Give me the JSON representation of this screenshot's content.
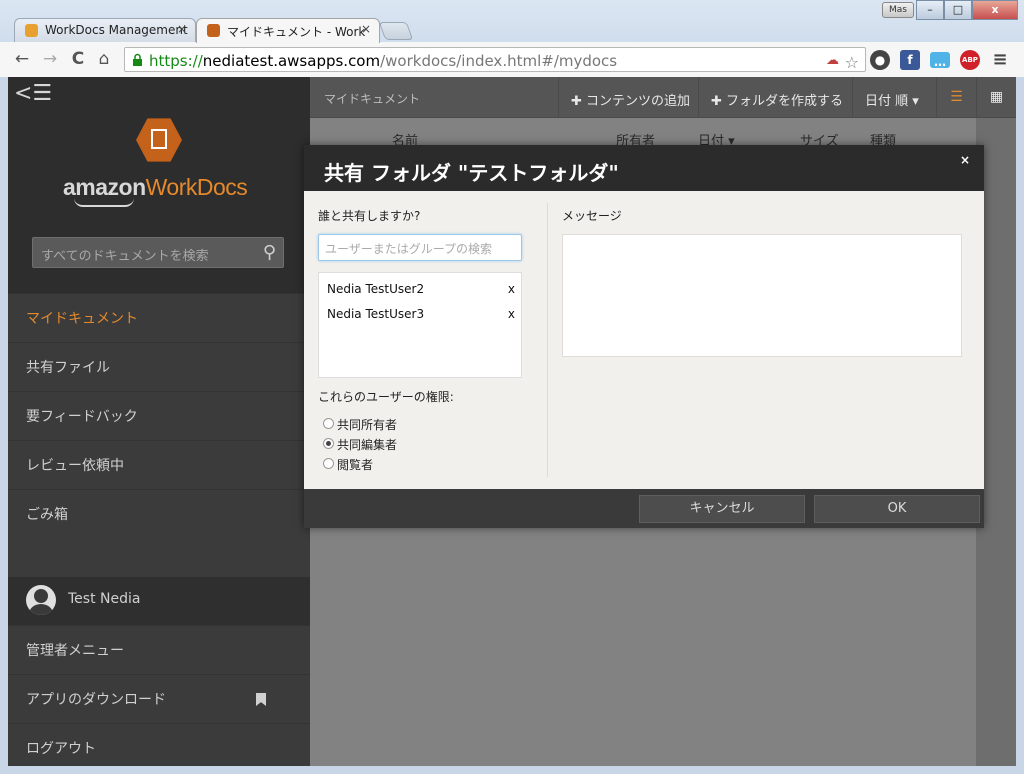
{
  "browser": {
    "tabs": [
      {
        "title": "WorkDocs Management",
        "close": "×"
      },
      {
        "title": "マイドキュメント - Work",
        "close": "×"
      }
    ],
    "user_badge": "Mas",
    "window_buttons": {
      "minimize": "–",
      "maximize": "□",
      "close": "x"
    },
    "nav": {
      "back": "←",
      "forward": "→",
      "reload": "C",
      "home": "⌂"
    },
    "url": {
      "scheme": "https://",
      "host": "nediatest.awsapps.com",
      "path": "/workdocs/index.html#/mydocs"
    },
    "extensions": {
      "abp": "ABP",
      "menu": "≡"
    }
  },
  "sidebar": {
    "collapse_icon": "<☰",
    "logo": {
      "amazon": "amazon",
      "workdocs": "WorkDocs"
    },
    "search_placeholder": "すべてのドキュメントを検索",
    "nav": [
      {
        "label": "マイドキュメント",
        "active": true
      },
      {
        "label": "共有ファイル"
      },
      {
        "label": "要フィードバック"
      },
      {
        "label": "レビュー依頼中"
      },
      {
        "label": "ごみ箱"
      }
    ],
    "user_name": "Test Nedia",
    "bottom": [
      {
        "label": "管理者メニュー"
      },
      {
        "label": "アプリのダウンロード"
      },
      {
        "label": "ログアウト"
      }
    ]
  },
  "main": {
    "breadcrumb": "マイドキュメント",
    "add_content": "✚ コンテンツの追加",
    "create_folder": "✚ フォルダを作成する",
    "sort": "日付 順 ▾",
    "columns": {
      "name": "名前",
      "owner": "所有者",
      "date": "日付 ▾",
      "size": "サイズ",
      "type": "種類"
    }
  },
  "modal": {
    "title": "共有 フォルダ \"テストフォルダ\"",
    "close": "×",
    "who_label": "誰と共有しますか?",
    "search_placeholder": "ユーザーまたはグループの検索",
    "users": [
      {
        "name": "Nedia TestUser2",
        "remove": "x"
      },
      {
        "name": "Nedia TestUser3",
        "remove": "x"
      }
    ],
    "permissions_label": "これらのユーザーの権限:",
    "permissions": [
      {
        "label": "共同所有者",
        "selected": false
      },
      {
        "label": "共同編集者",
        "selected": true
      },
      {
        "label": "閲覧者",
        "selected": false
      }
    ],
    "message_label": "メッセージ",
    "cancel": "キャンセル",
    "ok": "OK"
  }
}
